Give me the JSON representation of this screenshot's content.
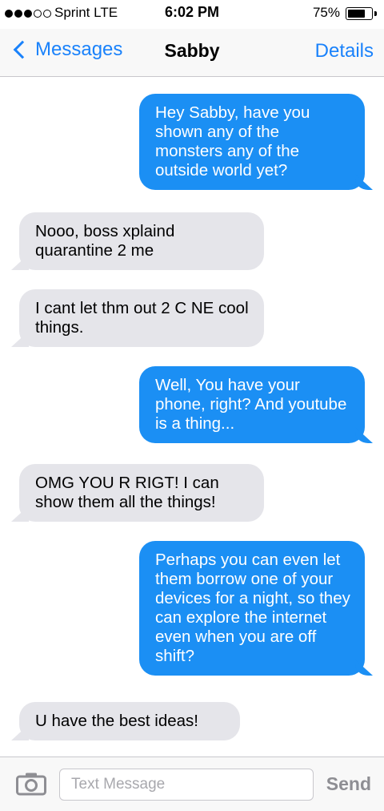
{
  "status_bar": {
    "carrier": "Sprint  LTE",
    "time": "6:02 PM",
    "battery": "75%",
    "battery_level": 0.75,
    "signal_bars_filled": 3,
    "signal_bars_total": 5
  },
  "nav": {
    "back_label": "Messages",
    "contact_name": "Sabby",
    "details_label": "Details"
  },
  "messages": [
    {
      "direction": "outgoing",
      "text": "Hey Sabby, have you shown any of the monsters any of the outside world yet?"
    },
    {
      "direction": "incoming",
      "text": "Nooo, boss xplaind quarantine 2 me"
    },
    {
      "direction": "incoming",
      "text": "I cant let thm out 2 C NE cool things."
    },
    {
      "direction": "outgoing",
      "text": "Well, You have your phone, right? And youtube is a thing..."
    },
    {
      "direction": "incoming",
      "text": "OMG YOU R RIGT! I can show them all the things!"
    },
    {
      "direction": "outgoing",
      "text": "Perhaps you can even let them borrow one of your devices for a night, so they can explore the internet even when you are off shift?"
    },
    {
      "direction": "incoming",
      "text": "U have the best ideas!"
    }
  ],
  "input_bar": {
    "placeholder": "Text Message",
    "value": "",
    "send_label": "Send",
    "camera_icon": "camera-icon"
  },
  "colors": {
    "accent": "#1a82fb",
    "outgoing_bubble": "#1b8ff4",
    "incoming_bubble": "#e5e5ea"
  }
}
